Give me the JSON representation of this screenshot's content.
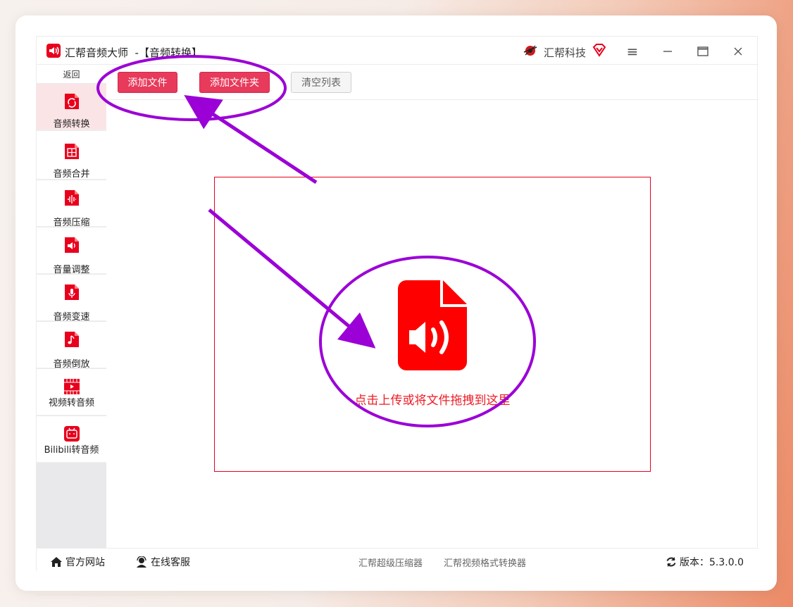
{
  "window": {
    "title": "汇帮音频大师  -【音频转换】",
    "brand_name": "汇帮科技",
    "controls": {
      "menu": "≡",
      "minimize": "—",
      "maximize": "▭",
      "close": "✕"
    }
  },
  "sidebar": {
    "back_label": "返回",
    "items": [
      {
        "label": "音频转换",
        "icon": "audio-convert-icon",
        "active": true
      },
      {
        "label": "音频合并",
        "icon": "audio-merge-icon"
      },
      {
        "label": "音频压缩",
        "icon": "audio-compress-icon"
      },
      {
        "label": "音量调整",
        "icon": "volume-adjust-icon"
      },
      {
        "label": "音频变速",
        "icon": "audio-speed-icon"
      },
      {
        "label": "音频倒放",
        "icon": "audio-reverse-icon"
      },
      {
        "label": "视频转音频",
        "icon": "video-to-audio-icon"
      },
      {
        "label": "Bilibili转音频",
        "icon": "bilibili-icon"
      }
    ]
  },
  "toolbar": {
    "add_file": "添加文件",
    "add_folder": "添加文件夹",
    "clear_list": "清空列表"
  },
  "dropzone": {
    "text": "点击上传或将文件拖拽到这里",
    "icon": "audio-file-icon"
  },
  "footer": {
    "website": "官方网站",
    "support": "在线客服",
    "link1": "汇帮超级压缩器",
    "link2": "汇帮视频格式转换器",
    "version": "版本：5.3.0.0"
  },
  "colors": {
    "accent_red": "#e83a5b",
    "icon_red": "#ff0000",
    "annotation_purple": "#9b00d6"
  }
}
